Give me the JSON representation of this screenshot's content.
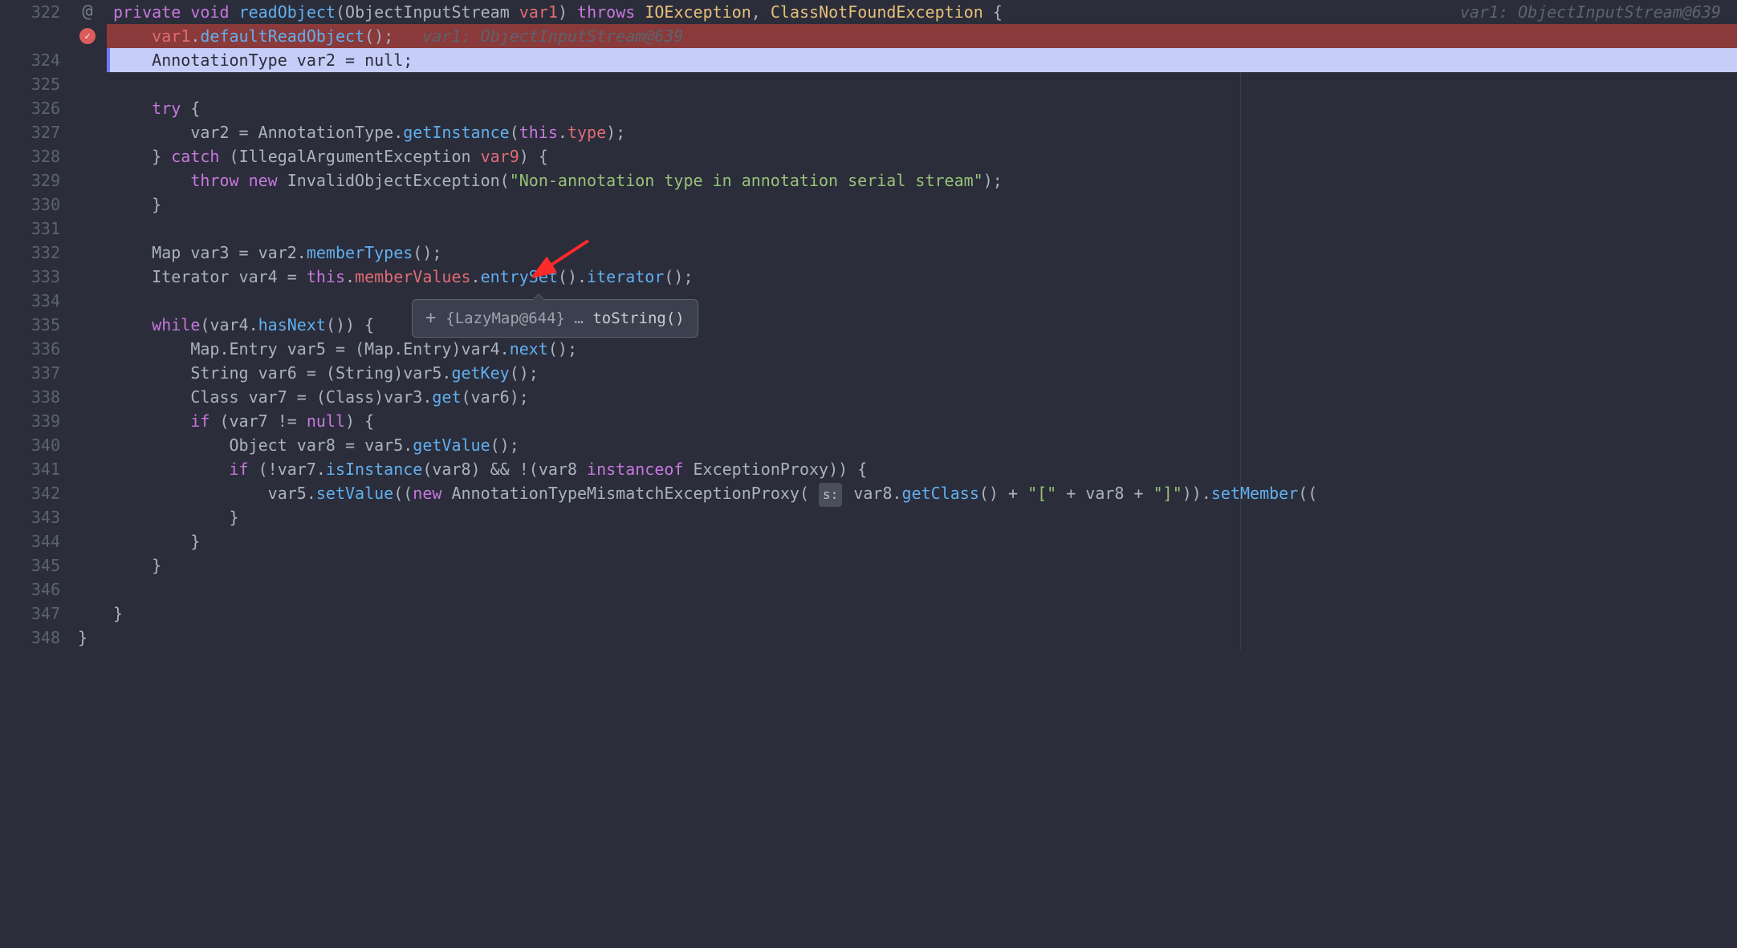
{
  "gutter": {
    "start": 322,
    "end": 348,
    "icons": {
      "322": "at",
      "323": "breakpoint"
    }
  },
  "tooltip": {
    "plus": "+",
    "content": "{LazyMap@644}",
    "dots": "…",
    "method": "toString()"
  },
  "ghost": {
    "line322": "var1: ObjectInputStream@639",
    "line323": "var1: ObjectInputStream@639"
  },
  "code": {
    "l322": {
      "kw1": "private",
      "kw2": "void",
      "fn": "readObject",
      "p1": "(",
      "type1": "ObjectInputStream ",
      "var1": "var1",
      "p2": ") ",
      "kw3": "throws",
      "sp1": " ",
      "type2": "IOException",
      "p3": ", ",
      "type3": "ClassNotFoundException",
      "p4": " {"
    },
    "l323": {
      "var1": "var1",
      "dot": ".",
      "fn": "defaultReadObject",
      "p": "();"
    },
    "l324": {
      "t1": "AnnotationType var2 = ",
      "kw": "null",
      "t2": ";"
    },
    "l326": {
      "kw": "try",
      "p": " {"
    },
    "l327": {
      "t1": "var2 = AnnotationType.",
      "fn": "getInstance",
      "p1": "(",
      "kw": "this",
      "dot": ".",
      "m": "type",
      "p2": ");"
    },
    "l328": {
      "p1": "} ",
      "kw": "catch",
      "p2": " (IllegalArgumentException ",
      "v": "var9",
      "p3": ") {"
    },
    "l329": {
      "kw1": "throw",
      "sp": " ",
      "kw2": "new",
      "t1": " InvalidObjectException(",
      "str": "\"Non-annotation type in annotation serial stream\"",
      "t2": ");"
    },
    "l330": {
      "p": "}"
    },
    "l332": {
      "t1": "Map var3 = var2.",
      "fn": "memberTypes",
      "p": "();"
    },
    "l333": {
      "t1": "Iterator var4 = ",
      "kw": "this",
      "dot": ".",
      "m": "memberValues",
      "dot2": ".",
      "fn1": "entrySet",
      "p1": "().",
      "fn2": "iterator",
      "p2": "();"
    },
    "l335": {
      "kw": "while",
      "t1": "(var4.",
      "fn": "hasNext",
      "t2": "()) {"
    },
    "l336": {
      "t1": "Map.Entry var5 = (Map.Entry)var4.",
      "fn": "next",
      "p": "();"
    },
    "l337": {
      "t1": "String var6 = (String)var5.",
      "fn": "getKey",
      "p": "();"
    },
    "l338": {
      "t1": "Class var7 = (Class)var3.",
      "fn": "get",
      "p": "(var6);"
    },
    "l339": {
      "kw": "if",
      "t1": " (var7 != ",
      "kw2": "null",
      "t2": ") {"
    },
    "l340": {
      "t1": "Object var8 = var5.",
      "fn": "getValue",
      "p": "();"
    },
    "l341": {
      "kw": "if",
      "t1": " (!var7.",
      "fn": "isInstance",
      "t2": "(var8) && !(var8 ",
      "kw2": "instanceof",
      "t3": " ExceptionProxy)) {"
    },
    "l342": {
      "t1": "var5.",
      "fn1": "setValue",
      "t2": "((",
      "kw": "new",
      "t3": " AnnotationTypeMismatchExceptionProxy( ",
      "badge": "s:",
      "t4": " var8.",
      "fn2": "getClass",
      "t5": "() + ",
      "s1": "\"[\"",
      "t6": " + var8 + ",
      "s2": "\"]\"",
      "t7": ")).",
      "fn3": "setMember",
      "t8": "(("
    },
    "l343": {
      "p": "}"
    },
    "l344": {
      "p": "}"
    },
    "l345": {
      "p": "}"
    },
    "l347": {
      "p": "}"
    },
    "l348": {
      "p": "}"
    }
  }
}
